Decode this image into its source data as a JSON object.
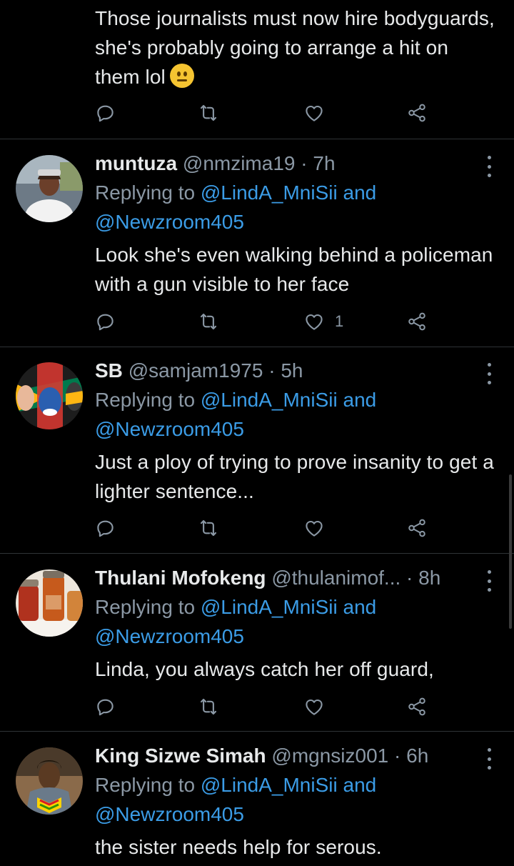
{
  "top_tweet": {
    "text": "Those journalists must now hire bodyguards, she's probably going to arrange a hit on them lol",
    "emoji": "neutral-face-emoji"
  },
  "replies": [
    {
      "name": "muntuza",
      "handle": "@nmzima19",
      "separator": "·",
      "time": "7h",
      "replying_prefix": "Replying to",
      "mention1": "@LindA_MniSii",
      "and_word": "and",
      "mention2": "@Newzroom405",
      "text": "Look she's even walking behind a policeman with a gun visible to her face",
      "likes": "1"
    },
    {
      "name": "SB",
      "handle": "@samjam1975",
      "separator": "·",
      "time": "5h",
      "replying_prefix": "Replying to",
      "mention1": "@LindA_MniSii",
      "and_word": "and",
      "mention2": "@Newzroom405",
      "text": "Just a ploy of trying to prove insanity to get a lighter sentence...",
      "likes": ""
    },
    {
      "name": "Thulani Mofokeng",
      "handle": "@thulanimof...",
      "separator": "·",
      "time": "8h",
      "replying_prefix": "Replying to",
      "mention1": "@LindA_MniSii",
      "and_word": "and",
      "mention2": "@Newzroom405",
      "text": "Linda, you always catch her off guard,",
      "likes": ""
    },
    {
      "name": "King Sizwe Simah",
      "handle": "@mgnsiz001",
      "separator": "·",
      "time": "6h",
      "replying_prefix": "Replying to",
      "mention1": "@LindA_MniSii",
      "and_word": "and",
      "mention2": "@Newzroom405",
      "text": "the sister needs help for serous.",
      "likes": ""
    }
  ],
  "colors": {
    "background": "#000000",
    "text": "#e7e9ea",
    "secondary": "#8b98a5",
    "link": "#3b9ce6",
    "divider": "#2f3336"
  },
  "icons": {
    "reply": "reply-icon",
    "retweet": "retweet-icon",
    "like": "heart-icon",
    "share": "share-icon",
    "more": "more-options-icon"
  }
}
